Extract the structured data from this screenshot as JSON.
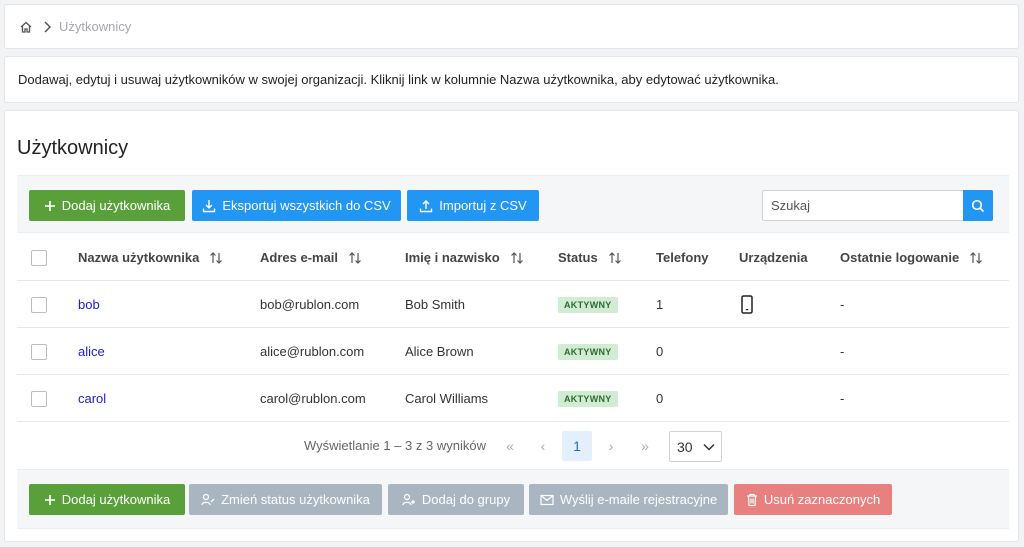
{
  "breadcrumb": {
    "home_icon": "home-icon",
    "current": "Użytkownicy"
  },
  "description": "Dodawaj, edytuj i usuwaj użytkowników w swojej organizacji. Kliknij link w kolumnie Nazwa użytkownika, aby edytować użytkownika.",
  "page_title": "Użytkownicy",
  "toolbar": {
    "add_user": "Dodaj użytkownika",
    "export_csv": "Eksportuj wszystkich do CSV",
    "import_csv": "Importuj z CSV",
    "search_placeholder": "Szukaj"
  },
  "table": {
    "headers": {
      "username": "Nazwa użytkownika",
      "email": "Adres e-mail",
      "name": "Imię i nazwisko",
      "status": "Status",
      "phones": "Telefony",
      "devices": "Urządzenia",
      "last_login": "Ostatnie logowanie"
    },
    "rows": [
      {
        "username": "bob",
        "email": "bob@rublon.com",
        "name": "Bob Smith",
        "status": "AKTYWNY",
        "phones": "1",
        "devices": "phone-icon",
        "last_login": "-"
      },
      {
        "username": "alice",
        "email": "alice@rublon.com",
        "name": "Alice Brown",
        "status": "AKTYWNY",
        "phones": "0",
        "devices": "",
        "last_login": "-"
      },
      {
        "username": "carol",
        "email": "carol@rublon.com",
        "name": "Carol Williams",
        "status": "AKTYWNY",
        "phones": "0",
        "devices": "",
        "last_login": "-"
      }
    ]
  },
  "pagination": {
    "info": "Wyświetlanie 1 – 3 z 3 wyników",
    "first": "«",
    "prev": "‹",
    "current_page": "1",
    "next": "›",
    "last": "»",
    "per_page": "30"
  },
  "bottom_actions": {
    "add_user": "Dodaj użytkownika",
    "change_status": "Zmień status użytkownika",
    "add_to_group": "Dodaj do grupy",
    "send_emails": "Wyślij e-maile rejestracyjne",
    "delete_selected": "Usuń zaznaczonych"
  },
  "colors": {
    "green": "#5aa03a",
    "blue": "#2196f3",
    "grey": "#a9b6c1",
    "red": "#e8807f",
    "badge_bg": "#d2ecd3",
    "link": "#1a1adb"
  }
}
